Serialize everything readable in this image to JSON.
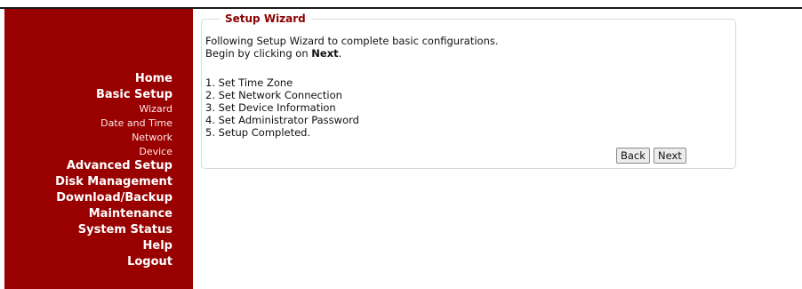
{
  "sidebar": {
    "items": [
      {
        "label": "Home",
        "type": "main"
      },
      {
        "label": "Basic Setup",
        "type": "main"
      },
      {
        "label": "Wizard",
        "type": "sub"
      },
      {
        "label": "Date and Time",
        "type": "sub"
      },
      {
        "label": "Network",
        "type": "sub"
      },
      {
        "label": "Device",
        "type": "sub"
      },
      {
        "label": "Advanced Setup",
        "type": "main"
      },
      {
        "label": "Disk Management",
        "type": "main"
      },
      {
        "label": "Download/Backup",
        "type": "main"
      },
      {
        "label": "Maintenance",
        "type": "main"
      },
      {
        "label": "System Status",
        "type": "main"
      },
      {
        "label": "Help",
        "type": "main"
      },
      {
        "label": "Logout",
        "type": "main"
      }
    ]
  },
  "wizard": {
    "title": "Setup Wizard",
    "intro": "Following Setup Wizard to complete basic configurations.",
    "begin_prefix": "Begin by clicking on ",
    "begin_bold": "Next",
    "begin_suffix": ".",
    "steps": [
      "1. Set Time Zone",
      "2. Set Network Connection",
      "3. Set Device Information",
      "4. Set Administrator Password",
      "5. Setup Completed."
    ],
    "back_label": "Back",
    "next_label": "Next"
  },
  "colors": {
    "sidebar_bg": "#990000",
    "title": "#8b0000"
  }
}
